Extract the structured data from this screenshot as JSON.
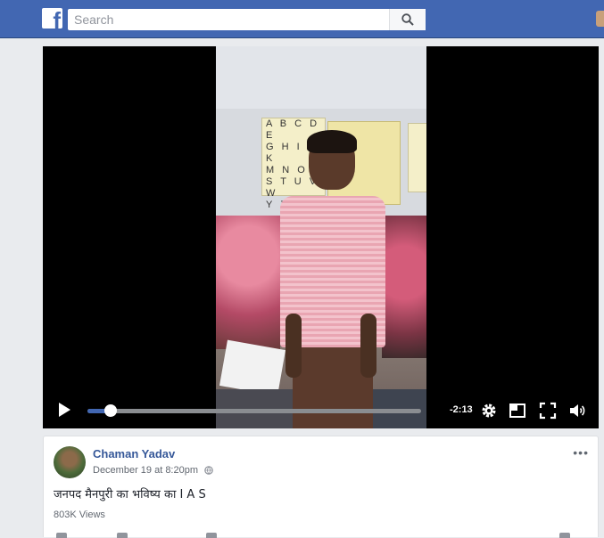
{
  "topbar": {
    "logo_letter": "f",
    "search": {
      "placeholder": "Search",
      "icon": "search-icon"
    },
    "colors": {
      "bar": "#4267b2"
    }
  },
  "video": {
    "poster_text": {
      "alphabet_lines": [
        "A B C D E",
        "G H I J K",
        "M N O P",
        "S T U V W",
        "Y Z"
      ]
    },
    "controls": {
      "play_icon": "play-icon",
      "progress": 0.07,
      "time_remaining": "-2:13",
      "settings_icon": "gear-icon",
      "pip_icon": "picture-in-picture-icon",
      "fullscreen_icon": "fullscreen-icon",
      "volume_icon": "volume-icon"
    },
    "colors": {
      "progress": "#4267b2"
    }
  },
  "post": {
    "author": "Chaman Yadav",
    "date": "December 19 at 8:20pm",
    "privacy_icon": "globe-icon",
    "more_label": "•••",
    "text": "जनपद मैनपुरी का भविष्य का I A S",
    "views": "803K Views"
  }
}
